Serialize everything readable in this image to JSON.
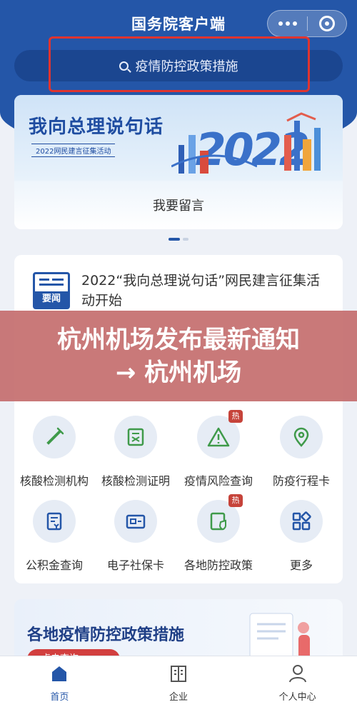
{
  "header": {
    "title": "国务院客户端"
  },
  "search": {
    "placeholder": "疫情防控政策措施"
  },
  "banner": {
    "title": "我向总理说句话",
    "subtitle": "2022网民建言征集活动",
    "year": "2022",
    "action_label": "我要留言"
  },
  "news": {
    "badge": "要闻",
    "headline": "2022“我向总理说句话”网民建言征集活动开始"
  },
  "overlay": {
    "text": "杭州机场发布最新通知 → 杭州机场"
  },
  "services": [
    {
      "label": "核酸检测机构",
      "icon": "test-tube-icon",
      "hot": false
    },
    {
      "label": "核酸检测证明",
      "icon": "certificate-icon",
      "hot": false
    },
    {
      "label": "疫情风险查询",
      "icon": "warning-icon",
      "hot": true,
      "hot_label": "热"
    },
    {
      "label": "防疫行程卡",
      "icon": "location-pin-icon",
      "hot": false
    },
    {
      "label": "公积金查询",
      "icon": "fund-document-icon",
      "hot": false
    },
    {
      "label": "电子社保卡",
      "icon": "id-card-icon",
      "hot": false
    },
    {
      "label": "各地防控政策",
      "icon": "shield-document-icon",
      "hot": true,
      "hot_label": "热"
    },
    {
      "label": "更多",
      "icon": "grid-apps-icon",
      "hot": false
    }
  ],
  "promo": {
    "title": "各地疫情防控政策措施",
    "button": "点击查询 >"
  },
  "tabbar": [
    {
      "label": "首页",
      "icon": "home-icon",
      "active": true
    },
    {
      "label": "企业",
      "icon": "building-icon",
      "active": false
    },
    {
      "label": "个人中心",
      "icon": "person-icon",
      "active": false
    }
  ],
  "colors": {
    "primary": "#2456a8",
    "highlight": "#e0342f",
    "hot": "#c6433a",
    "icon": "#3f9a4a"
  }
}
